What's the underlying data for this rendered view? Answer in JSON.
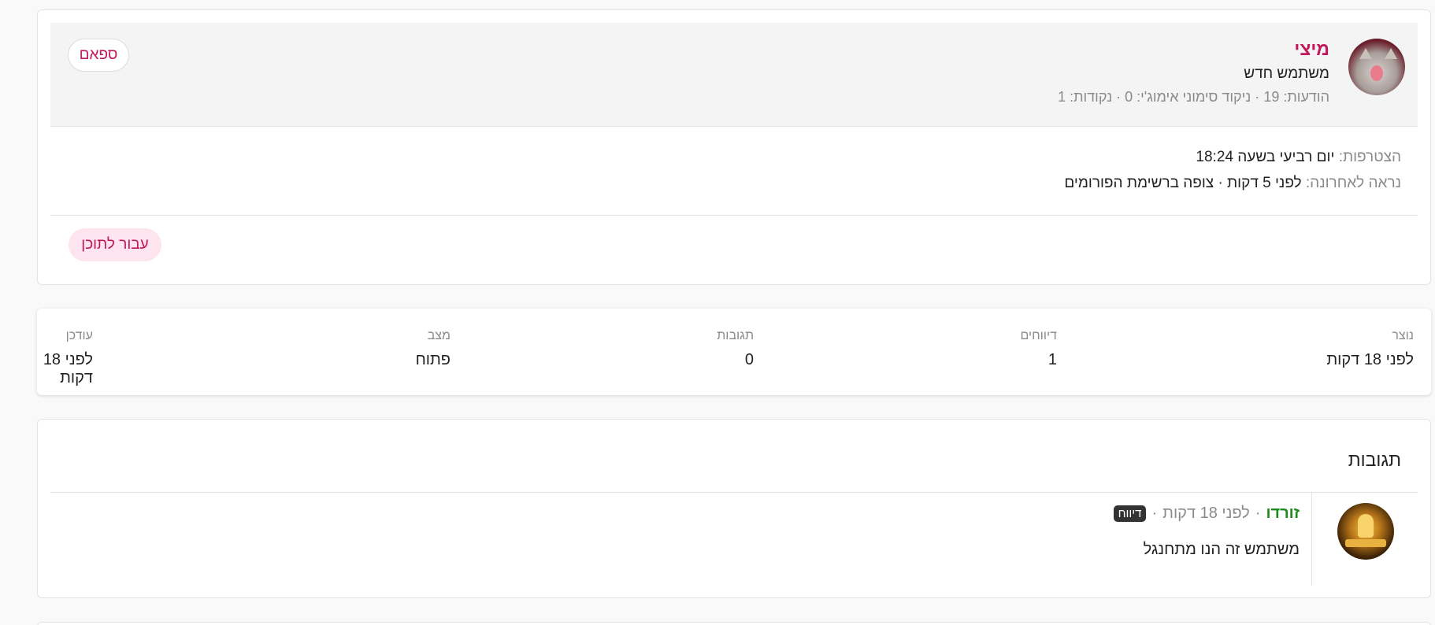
{
  "user": {
    "name": "מיצי",
    "title": "משתמש חדש",
    "stats_line": "הודעות: 19 · ניקוד סימוני אימוג'י: 0 · נקודות: 1",
    "spam_label": "ספאם",
    "joined_label": "הצטרפות:",
    "joined_value": "יום רביעי בשעה 18:24",
    "seen_label": "נראה לאחרונה:",
    "seen_value": "לפני 5 דקות · צופה ברשימת הפורומים",
    "goto_label": "עבור לתוכן"
  },
  "stats": {
    "created_label": "נוצר",
    "created_value": "לפני 18 דקות",
    "reports_label": "דיווחים",
    "reports_value": "1",
    "replies_label": "תגובות",
    "replies_value": "0",
    "status_label": "מצב",
    "status_value": "פתוח",
    "updated_label": "עודכן",
    "updated_value": "לפני 18 דקות"
  },
  "replies": {
    "title": "תגובות",
    "items": [
      {
        "author": "זורדו",
        "sep1": "·",
        "time": "לפני 18 דקות",
        "sep2": "·",
        "badge": "דיווח",
        "body": "משתמש זה הנו מתחנגל"
      }
    ]
  },
  "colors": {
    "accent": "#c2185b",
    "author": "#1d8a1d",
    "muted": "#8a8a8a"
  }
}
